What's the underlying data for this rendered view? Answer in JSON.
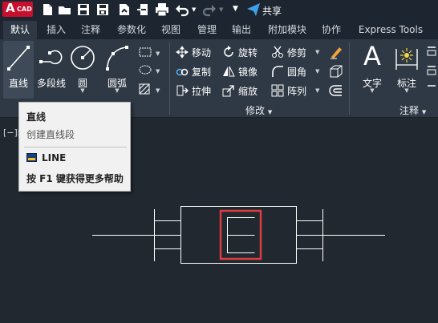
{
  "app": {
    "logo_letter": "A",
    "logo_text": "CAD",
    "brand_color": "#c8102e"
  },
  "quick_access": {
    "icons": [
      "new-icon",
      "open-icon",
      "save-icon",
      "save-as-icon",
      "open-web-icon",
      "save-web-icon",
      "plot-icon",
      "undo-icon",
      "redo-icon",
      "customize-icon"
    ],
    "share_label": "共享"
  },
  "tabs": [
    "默认",
    "插入",
    "注释",
    "参数化",
    "视图",
    "管理",
    "输出",
    "附加模块",
    "协作",
    "Express Tools"
  ],
  "active_tab": "默认",
  "ribbon": {
    "draw": {
      "line": "直线",
      "polyline": "多段线",
      "circle": "圆",
      "arc": "圆弧"
    },
    "modify": {
      "title": "修改",
      "move": "移动",
      "rotate": "旋转",
      "trim": "修剪",
      "copy": "复制",
      "mirror": "镜像",
      "fillet": "圆角",
      "stretch": "拉伸",
      "scale": "缩放",
      "array": "阵列"
    },
    "annotation": {
      "title": "注释",
      "text": "文字",
      "dimension": "标注"
    }
  },
  "tooltip": {
    "title": "直线",
    "description": "创建直线段",
    "command": "LINE",
    "help": "按 F1 键获得更多帮助"
  },
  "viewport": {
    "label": "[−][",
    "highlight_color": "#e03c3c"
  }
}
